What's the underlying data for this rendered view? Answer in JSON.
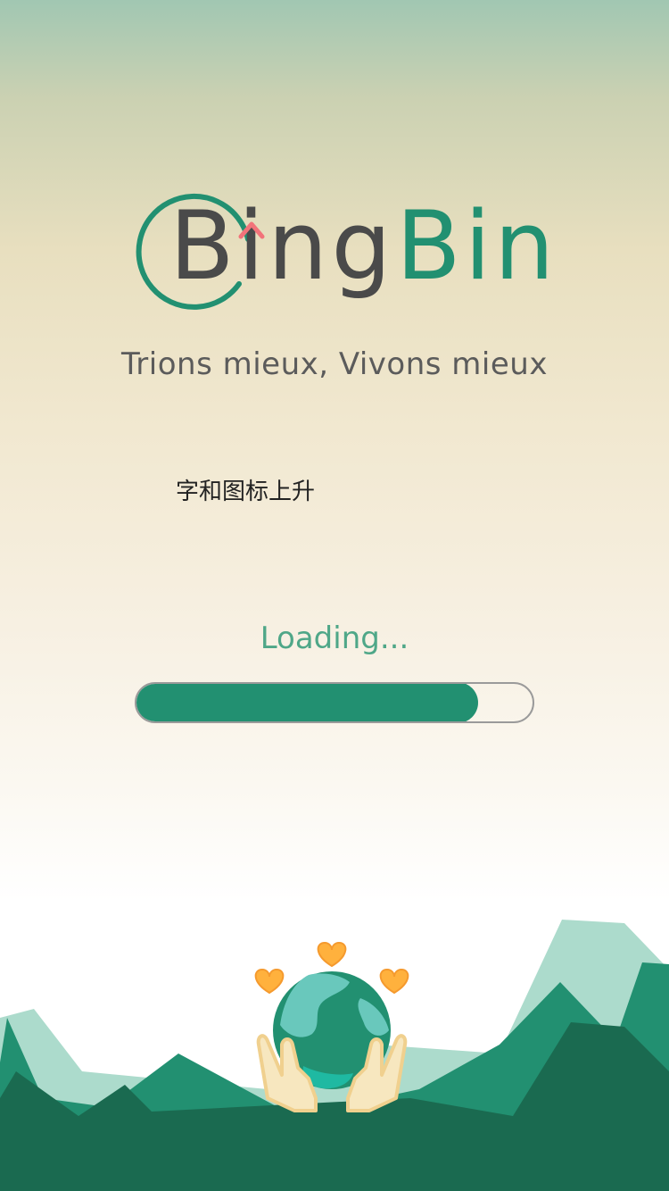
{
  "brand": {
    "name_part1": "Bing",
    "name_part2": "Bin",
    "tagline": "Trions mieux, Vivons mieux"
  },
  "note": "字和图标上升",
  "loading": {
    "label": "Loading...",
    "progress": 0.86
  },
  "icons": [
    "logo-ring-icon",
    "up-arrow-icon",
    "earth-in-hands-icon",
    "heart-icon"
  ],
  "colors": {
    "brand_green": "#229071",
    "dark_green": "#1a6a50",
    "light_green": "#acdbcc",
    "text_gray": "#4a4a4a",
    "accent_red": "#f2737a",
    "heart_orange": "#ffb13d"
  }
}
